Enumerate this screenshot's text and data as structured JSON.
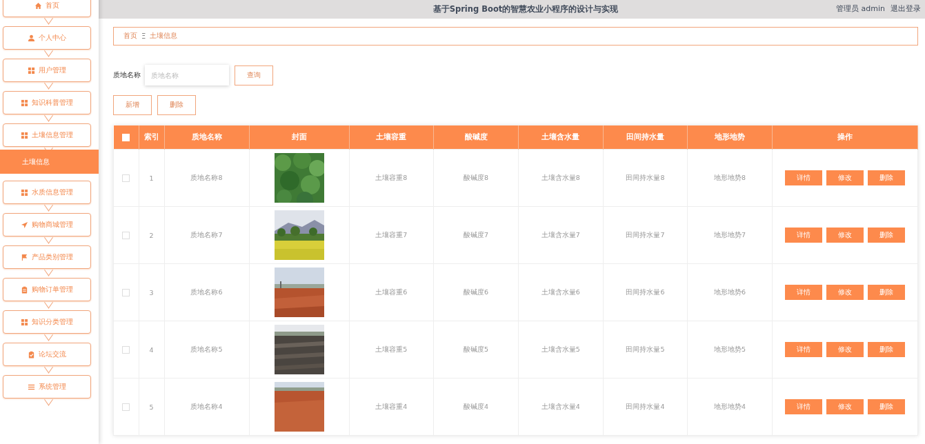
{
  "header": {
    "title": "基于Spring Boot的智慧农业小程序的设计与实现",
    "user": "管理员 admin",
    "logout": "退出登录"
  },
  "sidebar": {
    "items": [
      {
        "label": "首页",
        "kind": "home",
        "selected": false
      },
      {
        "label": "个人中心",
        "kind": "user",
        "selected": false
      },
      {
        "label": "用户管理",
        "kind": "grid",
        "selected": false
      },
      {
        "label": "知识科普管理",
        "kind": "grid",
        "selected": false
      },
      {
        "label": "土壤信息管理",
        "kind": "grid",
        "selected": false,
        "children": [
          {
            "label": "土壤信息",
            "selected": true
          }
        ]
      },
      {
        "label": "水质信息管理",
        "kind": "grid",
        "selected": false
      },
      {
        "label": "购物商城管理",
        "kind": "send",
        "selected": false
      },
      {
        "label": "产品类别管理",
        "kind": "flag",
        "selected": false
      },
      {
        "label": "购物订单管理",
        "kind": "clipboard",
        "selected": false
      },
      {
        "label": "知识分类管理",
        "kind": "grid",
        "selected": false
      },
      {
        "label": "论坛交流",
        "kind": "check",
        "selected": false
      },
      {
        "label": "系统管理",
        "kind": "list",
        "selected": false
      }
    ]
  },
  "breadcrumb": {
    "items": [
      "首页",
      "土壤信息"
    ],
    "separator": "Ξ"
  },
  "search": {
    "label": "质地名称",
    "placeholder": "质地名称",
    "button": "查询"
  },
  "actions": [
    "新增",
    "删除"
  ],
  "table": {
    "select_all": false,
    "columns": [
      "索引",
      "质地名称",
      "封面",
      "土壤容重",
      "酸碱度",
      "土壤含水量",
      "田间持水量",
      "地形地势",
      "操作"
    ],
    "rows": [
      {
        "checked": false,
        "cells": [
          "1",
          "质地名称8",
          {
            "kind": "picture"
          },
          "土壤容重8",
          "酸碱度8",
          "土壤含水量8",
          "田间持水量8",
          "地形地势8"
        ],
        "buttons": [
          "详情",
          "修改",
          "删除"
        ]
      },
      {
        "checked": false,
        "cells": [
          "2",
          "质地名称7",
          {
            "kind": "picture"
          },
          "土壤容重7",
          "酸碱度7",
          "土壤含水量7",
          "田间持水量7",
          "地形地势7"
        ],
        "buttons": [
          "详情",
          "修改",
          "删除"
        ]
      },
      {
        "checked": false,
        "cells": [
          "3",
          "质地名称6",
          {
            "kind": "picture"
          },
          "土壤容重6",
          "酸碱度6",
          "土壤含水量6",
          "田间持水量6",
          "地形地势6"
        ],
        "buttons": [
          "详情",
          "修改",
          "删除"
        ]
      },
      {
        "checked": false,
        "cells": [
          "4",
          "质地名称5",
          {
            "kind": "picture"
          },
          "土壤容重5",
          "酸碱度5",
          "土壤含水量5",
          "田间持水量5",
          "地形地势5"
        ],
        "buttons": [
          "详情",
          "修改",
          "删除"
        ]
      },
      {
        "checked": false,
        "cells": [
          "5",
          "质地名称4",
          {
            "kind": "picture"
          },
          "土壤容重4",
          "酸碱度4",
          "土壤含水量4",
          "田间持水量4",
          "地形地势4"
        ],
        "buttons": [
          "详情",
          "修改",
          "删除"
        ]
      }
    ]
  }
}
